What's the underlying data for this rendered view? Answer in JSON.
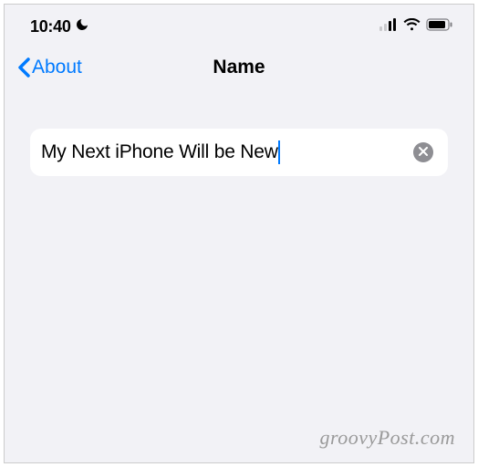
{
  "status_bar": {
    "time": "10:40",
    "dnd_icon": "moon-icon",
    "signal_bars": 2,
    "wifi": true,
    "battery_level": 85
  },
  "nav": {
    "back_label": "About",
    "title": "Name"
  },
  "form": {
    "name_value": "My Next iPhone Will be New",
    "clear_icon": "clear-icon"
  },
  "watermark": "groovyPost.com",
  "colors": {
    "accent": "#007aff",
    "bg": "#f2f2f6",
    "card": "#ffffff",
    "clear_btn": "#8e8e93"
  }
}
